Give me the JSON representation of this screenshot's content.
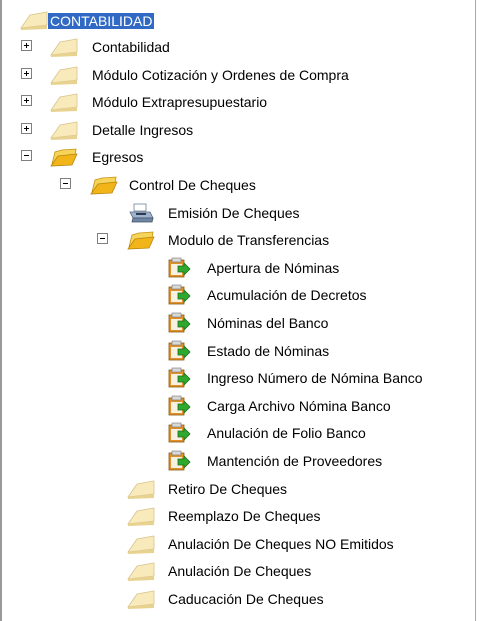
{
  "tree": {
    "root": {
      "label": "CONTABILIDAD",
      "icon": "folder-closed-icon",
      "selected": true
    },
    "items": [
      {
        "label": "Contabilidad",
        "toggle": "plus",
        "icon": "folder-closed-icon"
      },
      {
        "label": "Módulo Cotización y Ordenes de Compra",
        "toggle": "plus",
        "icon": "folder-closed-icon"
      },
      {
        "label": "Módulo Extrapresupuestario",
        "toggle": "plus",
        "icon": "folder-closed-icon"
      },
      {
        "label": "Detalle Ingresos",
        "toggle": "plus",
        "icon": "folder-closed-icon"
      },
      {
        "label": "Egresos",
        "toggle": "minus",
        "icon": "folder-open-icon"
      },
      {
        "label": "Control De Cheques",
        "toggle": "minus",
        "icon": "folder-open-icon"
      },
      {
        "label": "Emisión De Cheques",
        "toggle": "none",
        "icon": "printer-icon"
      },
      {
        "label": "Modulo de Transferencias",
        "toggle": "minus",
        "icon": "folder-open-icon"
      },
      {
        "label": "Apertura de Nóminas",
        "toggle": "none",
        "icon": "clipboard-arrow-icon"
      },
      {
        "label": "Acumulación de Decretos",
        "toggle": "none",
        "icon": "clipboard-arrow-icon"
      },
      {
        "label": "Nóminas del Banco",
        "toggle": "none",
        "icon": "clipboard-arrow-icon"
      },
      {
        "label": "Estado de Nóminas",
        "toggle": "none",
        "icon": "clipboard-arrow-icon"
      },
      {
        "label": "Ingreso Número de Nómina Banco",
        "toggle": "none",
        "icon": "clipboard-arrow-icon"
      },
      {
        "label": "Carga Archivo Nómina Banco",
        "toggle": "none",
        "icon": "clipboard-arrow-icon"
      },
      {
        "label": "Anulación de Folio Banco",
        "toggle": "none",
        "icon": "clipboard-arrow-icon"
      },
      {
        "label": "Mantención de Proveedores",
        "toggle": "none",
        "icon": "clipboard-arrow-icon"
      },
      {
        "label": "Retiro De Cheques",
        "toggle": "none",
        "icon": "folder-closed-icon"
      },
      {
        "label": "Reemplazo De Cheques",
        "toggle": "none",
        "icon": "folder-closed-icon"
      },
      {
        "label": "Anulación De Cheques NO Emitidos",
        "toggle": "none",
        "icon": "folder-closed-icon"
      },
      {
        "label": "Anulación De Cheques",
        "toggle": "none",
        "icon": "folder-closed-icon"
      },
      {
        "label": "Caducación De Cheques",
        "toggle": "none",
        "icon": "folder-closed-icon"
      }
    ]
  },
  "colors": {
    "selection": "#316ac5",
    "folder": "#f5e5a8",
    "folder_open": "#f2b519",
    "clipboard": "#e0912a",
    "arrow": "#2fa82f"
  }
}
